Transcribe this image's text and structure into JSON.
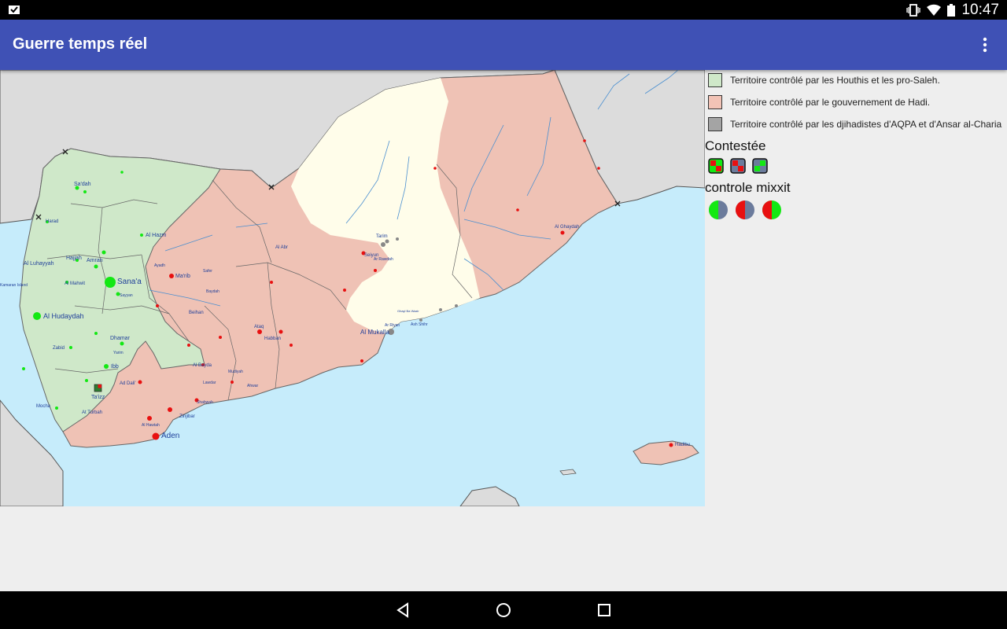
{
  "status_bar": {
    "time": "10:47",
    "icons": [
      "notification-icon",
      "vibrate-icon",
      "wifi-icon",
      "battery-icon"
    ]
  },
  "app_bar": {
    "title": "Guerre temps réel",
    "menu_icon": "overflow-menu-icon"
  },
  "legend": {
    "items": [
      {
        "label": "Territoire contrôlé par les Houthis et les pro-Saleh.",
        "color": "#cfe8c9"
      },
      {
        "label": "Territoire contrôlé par le gouvernement de Hadi.",
        "color": "#f2c3b6"
      },
      {
        "label": "Territoire contrôlé par les djihadistes d'AQPA et d'Ansar al-Charia",
        "color": "#a4a4a4"
      }
    ],
    "contested_title": "Contestée",
    "contested_icons": [
      "contested-green-red-icon",
      "contested-gray-red-icon",
      "contested-gray-green-icon"
    ],
    "mixed_title": "controle mixxit",
    "mixed_icons": [
      "mixed-green-gray-icon",
      "mixed-red-gray-icon",
      "mixed-red-green-icon"
    ]
  },
  "map": {
    "colors": {
      "sea": "#c6ecfb",
      "neighbor": "#dcdcdc",
      "houthi": "#cfe8c9",
      "hadi": "#efc2b5",
      "desert": "#fffdea",
      "aqpa": "#888888"
    },
    "labels": {
      "sanaa": "Sana'a",
      "hudaydah": "Al Hudaydah",
      "aden": "Aden",
      "mukalla": "Al Mukalla",
      "taizz": "Ta'izz",
      "ibb": "Ibb",
      "dhamar": "Dhamar",
      "hajjah": "Hajjah",
      "amran": "Amran",
      "sadah": "Sa'dah",
      "harad": "Harad",
      "hazm": "Al Hazm",
      "marib": "Ma'rib",
      "luhayyah": "Al Luhayyah",
      "zabid": "Zabid",
      "mocha": "Mocha",
      "ghaydah": "Al Ghaydah",
      "tarim": "Tarim",
      "seiyun": "Seiyun",
      "ataq": "Ataq",
      "habban": "Habban",
      "ahwar": "Ahwar",
      "zinjibar": "Zinjibar",
      "shabwah": "Shabwah",
      "bayda": "Al Bayda",
      "beihan": "Beihan",
      "mahwit": "Al Mahwit",
      "yarim": "Yarim",
      "turbah": "At Turbah",
      "dali": "Ad Dali'",
      "lawdar": "Lawdar",
      "mudiyah": "Mudiyah",
      "hadibu": "Hadibu",
      "alabr": "Al Abr",
      "ayadh": "Ayadh",
      "safer": "Safer",
      "baydah2": "Baydah",
      "rawdah": "Ar Rawdah",
      "shihr": "Ash Shihr",
      "ghayl": "Ghayl Ba Wazir",
      "riyan": "Ar Riyan",
      "hawtah": "Al Hawtah",
      "kamaran": "Kamaran Island",
      "sayyan": "Sayyan"
    }
  }
}
